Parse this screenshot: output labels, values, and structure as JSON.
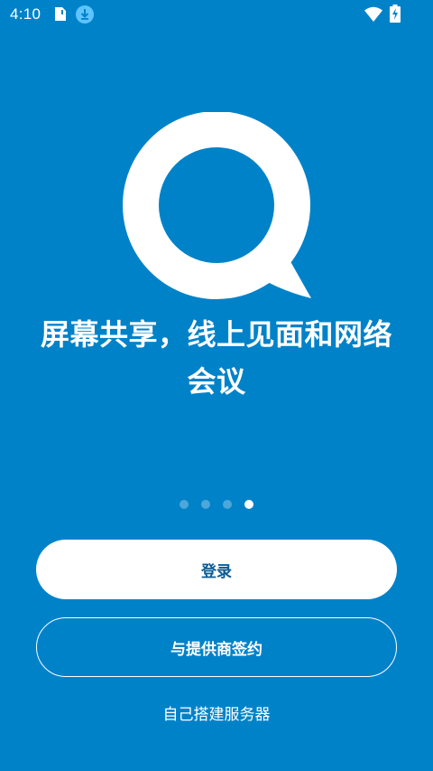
{
  "status_bar": {
    "time": "4:10",
    "icons": [
      "sim-card-icon",
      "download-icon",
      "wifi-icon",
      "battery-charging-icon"
    ]
  },
  "logo": {
    "icon": "speech-bubble-q-icon"
  },
  "headline": {
    "line1": "屏幕共享，线上见面和网络",
    "line2": "会议"
  },
  "pager": {
    "total": 4,
    "current": 4
  },
  "buttons": {
    "login_label": "登录",
    "provider_label": "与提供商签约"
  },
  "self_host": {
    "label": "自己搭建服务器"
  },
  "colors": {
    "background": "#0082c9",
    "login_text": "#0b5c93",
    "foreground": "#ffffff"
  }
}
